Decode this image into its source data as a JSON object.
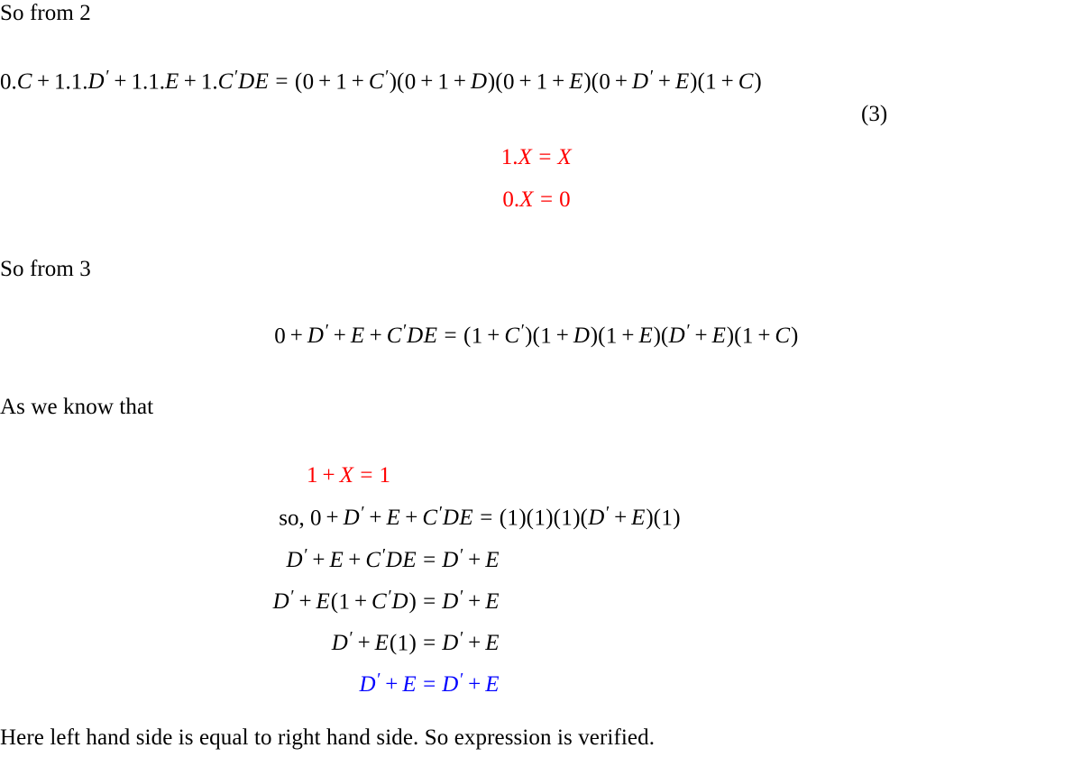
{
  "document": {
    "type": "boolean-algebra-proof",
    "background_color": "#ffffff",
    "text_color": "#000000",
    "highlight_red": "#ff0000",
    "highlight_blue": "#0000ff"
  },
  "lines": {
    "so_from_2": "So from 2",
    "so_from_3": "So from 3",
    "as_we_know_that": "As we know that",
    "conclusion": "Here left hand side is equal to right hand side. So expression is verified."
  },
  "equation_2_expansion": {
    "lhs": "0.C + 1.1.D' + 1.1.E + 1.C'DE",
    "rhs": "(0 + 1 + C')(0 + 1 + D)(0 + 1 + E)(0 + D' + E)(1 + C)",
    "full": "0.C + 1.1.D' + 1.1.E + 1.C'DE = (0 + 1 + C')(0 + 1 + D)(0 + 1 + E)(0 + D' + E)(1 + C)",
    "number": "(3)"
  },
  "identities_red_1": [
    {
      "text": "1.X = X"
    },
    {
      "text": "0.X = 0"
    }
  ],
  "equation_3_reduced": {
    "lhs": "0 + D' + E + C'DE",
    "rhs": "(1 + C')(1 + D)(1 + E)(D' + E)(1 + C)",
    "full": "0 + D' + E + C'DE = (1 + C')(1 + D)(1 + E)(D' + E)(1 + C)"
  },
  "identity_red_2": {
    "text": "1 + X = 1"
  },
  "derivation": [
    {
      "prefix": "so, ",
      "lhs": "0 + D' + E + C'DE",
      "rhs": "(1)(1)(1)(D' + E)(1)",
      "color": "#000000"
    },
    {
      "prefix": "",
      "lhs": "D' + E + C'DE",
      "rhs": "D' + E",
      "color": "#000000"
    },
    {
      "prefix": "",
      "lhs": "D' + E(1 + C'D)",
      "rhs": "D' + E",
      "color": "#000000"
    },
    {
      "prefix": "",
      "lhs": "D' + E(1)",
      "rhs": "D' + E",
      "color": "#000000"
    },
    {
      "prefix": "",
      "lhs": "D' + E",
      "rhs": "D' + E",
      "color": "#0000ff"
    }
  ]
}
